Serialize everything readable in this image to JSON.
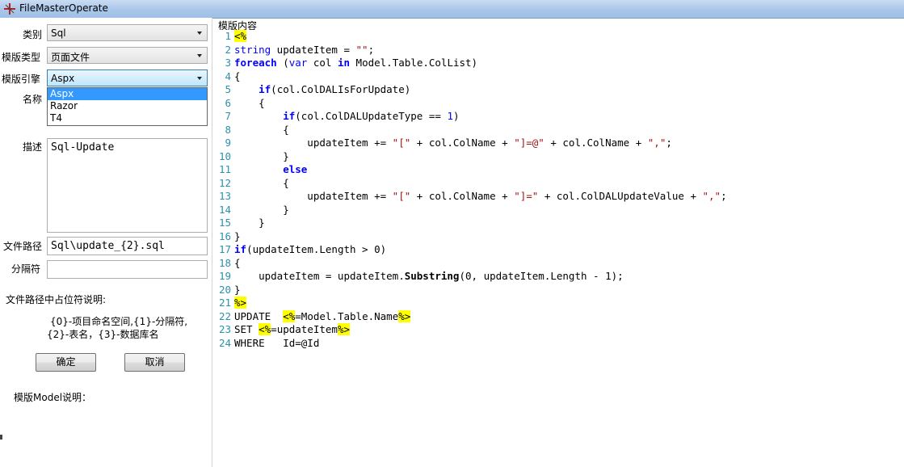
{
  "window": {
    "title": "FileMasterOperate"
  },
  "form": {
    "category_label": "类别",
    "category_value": "Sql",
    "template_type_label": "模版类型",
    "template_type_value": "页面文件",
    "template_engine_label": "模版引擎",
    "template_engine_value": "Aspx",
    "engine_options": [
      "Aspx",
      "Razor",
      "T4"
    ],
    "name_label": "名称",
    "description_label": "描述",
    "description_value": "Sql-Update",
    "filepath_label": "文件路径",
    "filepath_value": "Sql\\update_{2}.sql",
    "separator_label": "分隔符",
    "separator_value": "",
    "placeholder_help_title": "文件路径中占位符说明:",
    "placeholder_help_line1": "{0}-项目命名空间,{1}-分隔符,",
    "placeholder_help_line2": "{2}-表名，{3}-数据库名",
    "ok_button": "确定",
    "cancel_button": "取消",
    "model_help_label": "模版Model说明："
  },
  "editor": {
    "label": "模版内容",
    "line_count": 24
  },
  "colors": {
    "keyword": "#0000ff",
    "string": "#a31515",
    "line_number": "#2b91af",
    "highlight": "#ffff00",
    "selection": "#3399ff"
  }
}
